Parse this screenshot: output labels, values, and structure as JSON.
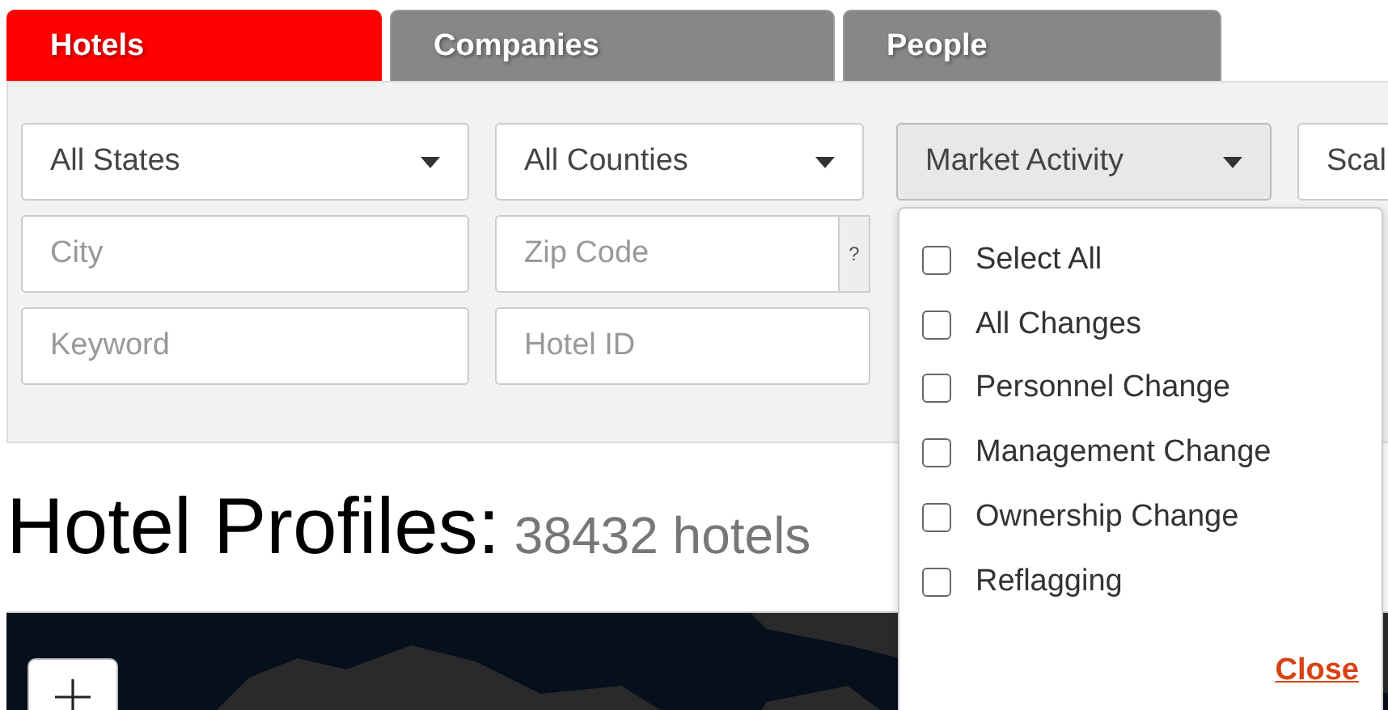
{
  "tabs": [
    {
      "label": "Hotels",
      "selected": true
    },
    {
      "label": "Companies",
      "selected": false
    },
    {
      "label": "People",
      "selected": false
    }
  ],
  "filters": {
    "selects": [
      {
        "value": "All States",
        "active": false
      },
      {
        "value": "All Counties",
        "active": false
      },
      {
        "value": "Market Activity",
        "active": true
      },
      {
        "value": "Scal",
        "active": false
      }
    ],
    "fields": [
      {
        "placeholder": "City"
      },
      {
        "placeholder": "Zip Code",
        "help": "?"
      },
      {
        "placeholder": "Keyword"
      },
      {
        "placeholder": "Hotel ID"
      }
    ]
  },
  "dropdown": {
    "options": [
      {
        "label": "Select All",
        "checked": false
      },
      {
        "label": "All Changes",
        "checked": false
      },
      {
        "label": "Personnel Change",
        "checked": false
      },
      {
        "label": "Management Change",
        "checked": false
      },
      {
        "label": "Ownership Change",
        "checked": false
      },
      {
        "label": "Reflagging",
        "checked": false
      }
    ],
    "close": "Close"
  },
  "heading": {
    "title": "Hotel Profiles:",
    "count": "38432 hotels"
  }
}
